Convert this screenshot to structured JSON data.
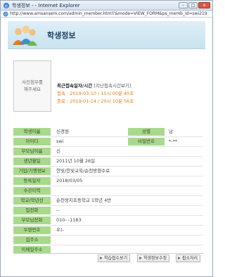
{
  "window": {
    "title": "학생정보 - - Internet Explorer",
    "url": "http://www.amsansem.com/admin_member.html?&mode=VIEW_FORM&ps_memb_id=swi219",
    "controls": {
      "minimize": "–",
      "maximize": "□",
      "close": "x"
    }
  },
  "header": {
    "title": "학생정보"
  },
  "photo": {
    "line1": "사진첨부를",
    "line2": "해주세요"
  },
  "login_info": {
    "label": "최근접속일자/시간",
    "link": "[지난접속시간보기]",
    "connect": "접속 : 2019-03-10 / 15시 00분 40초",
    "end": "종료 : 2019-01-14 / 20시 10분 56초"
  },
  "fields": {
    "name_label": "학생이름",
    "name_value": "신경원",
    "gender_label": "성별",
    "gender_value": "남",
    "id_label": "아이디",
    "id_value": "swi",
    "password_label": "비밀번호",
    "password_value": "*-**",
    "parent_label": "부모님이름",
    "parent_value": "신",
    "birth_label": "생년월일",
    "birth_value": "2011년 10월 26일",
    "institution_label": "기업/기행정보",
    "institution_value": "한빛/한빛교육/순천방향수료",
    "reg_label": "등록일자",
    "reg_value": "2018/03/05",
    "history_label": "수강이력",
    "history_value": "",
    "school_label": "학교/학년선",
    "school_value": "순천왕지초등학교 1학년 4반",
    "home_label": "집전화",
    "home_value": "--",
    "parent_phone_label": "부모님전화",
    "parent_phone_value": "010-     -1183",
    "zip_label": "우편번호",
    "zip_value": "우)-",
    "address_label": "집주소",
    "address_value": "",
    "email_label": "이메일주소",
    "email_value": ""
  },
  "buttons": {
    "learning": "학습접수보기",
    "edit": "학생정보수정",
    "close": "팝소처리"
  }
}
